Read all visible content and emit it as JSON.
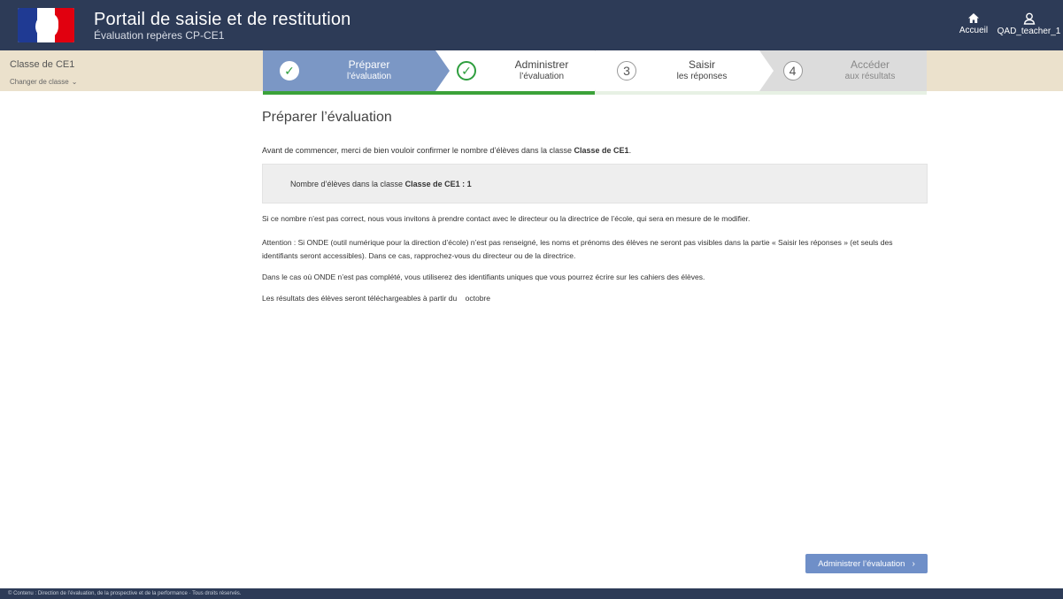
{
  "header": {
    "title": "Portail de saisie et de restitution",
    "subtitle": "Évaluation repères CP-CE1",
    "home_label": "Accueil",
    "user_label": "QAD_teacher_1"
  },
  "class_bar": {
    "class_name": "Classe de CE1",
    "change_label": "Changer de classe"
  },
  "stepper": {
    "steps": [
      {
        "main": "Préparer",
        "sub": "l’évaluation",
        "marker": "✓",
        "state": "done"
      },
      {
        "main": "Administrer",
        "sub": "l’évaluation",
        "marker": "✓",
        "state": "done"
      },
      {
        "main": "Saisir",
        "sub": "les réponses",
        "marker": "3",
        "state": "todo"
      },
      {
        "main": "Accéder",
        "sub": "aux résultats",
        "marker": "4",
        "state": "disabled"
      }
    ],
    "progress_fraction": 0.5
  },
  "main": {
    "title": "Préparer l’évaluation",
    "intro_prefix": "Avant de commencer, merci de bien vouloir confirmer le nombre d’élèves dans la classe ",
    "intro_class": "Classe de CE1",
    "intro_suffix": ".",
    "count_prefix": "Nombre d’élèves dans la classe ",
    "count_class": "Classe de CE1",
    "count_sep": " : ",
    "count_value": "1",
    "paragraph1": "Si ce nombre n’est pas correct, nous vous invitons à prendre contact avec le directeur ou la directrice de l’école, qui sera en mesure de le modifier.",
    "paragraph2": "Attention : Si ONDE (outil numérique pour la direction d’école) n’est pas renseigné, les noms et prénoms des élèves ne seront pas visibles dans la partie « Saisir les réponses » (et seuls des identifiants seront accessibles). Dans ce cas, rapprochez-vous du directeur ou de la directrice.",
    "paragraph3": "Dans le cas où ONDE n’est pas complété, vous utiliserez des identifiants uniques que vous pourrez écrire sur les cahiers des élèves.",
    "paragraph4": "Les résultats des élèves seront téléchargeables à partir du    octobre",
    "next_button": "Administrer l’évaluation"
  },
  "footer": {
    "text": "© Contenu : Direction de l’évaluation, de la prospective et de la performance · Tous droits réservés."
  },
  "colors": {
    "header_bg": "#2d3b57",
    "classbar_bg": "#ebe1cc",
    "step_active": "#7b97c5",
    "progress": "#3ba239",
    "button": "#6f8fc8"
  }
}
